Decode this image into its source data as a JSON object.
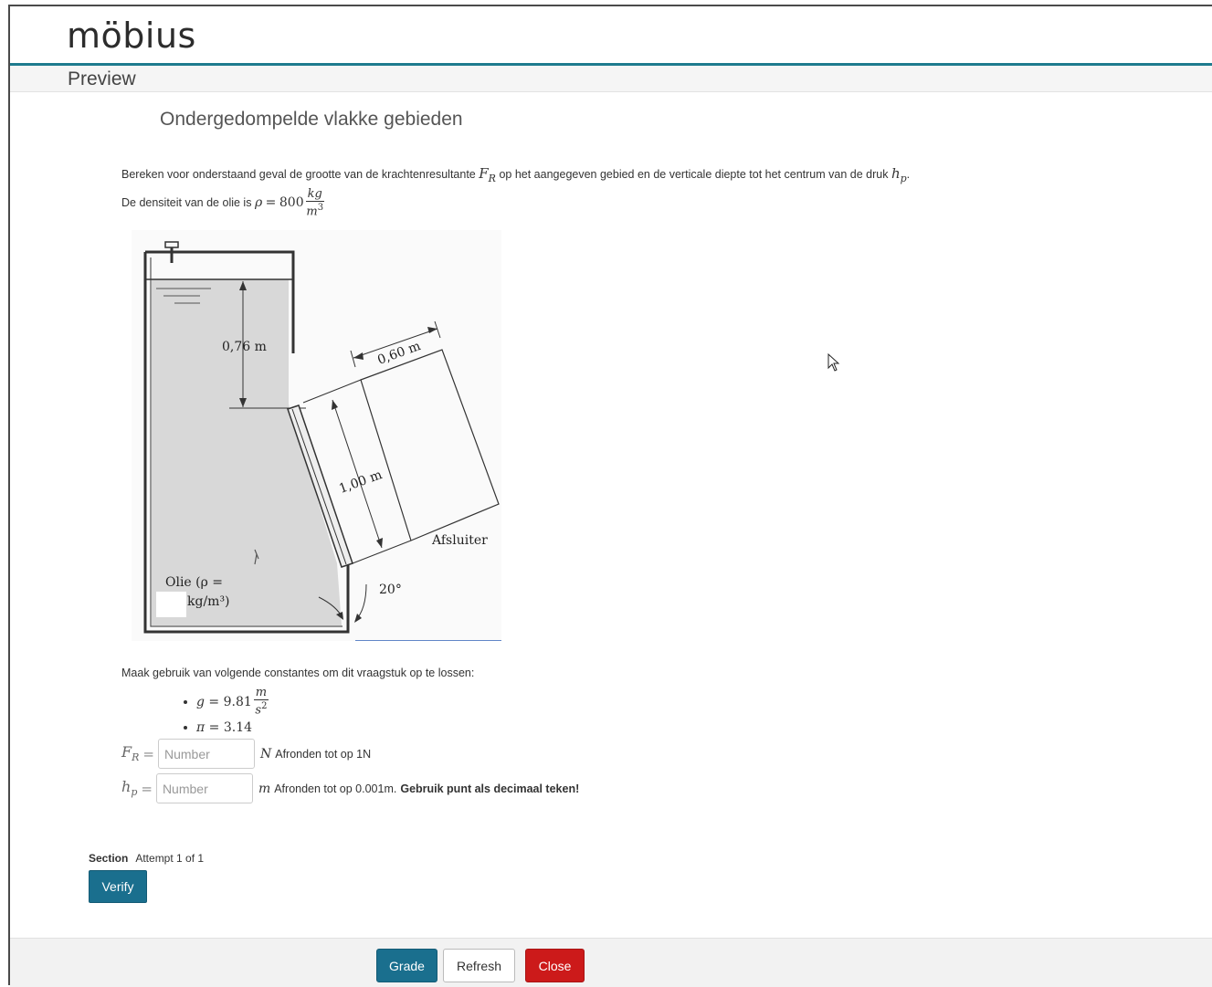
{
  "header": {
    "logo_text": "möbius",
    "preview_label": "Preview"
  },
  "question": {
    "title": "Ondergedompelde vlakke gebieden",
    "intro_before_FR": "Bereken voor onderstaand geval de grootte van de krachtenresultante",
    "FR_symbol": "F",
    "FR_sub": "R",
    "intro_middle": "op het aangegeven gebied en de verticale diepte tot het centrum van de druk",
    "hp_symbol": "h",
    "hp_sub": "p",
    "intro_end": ".",
    "density_prefix": "De densiteit van de olie is",
    "density_lhs": "ρ",
    "density_eq": "=",
    "density_value": "800",
    "density_unit_num": "kg",
    "density_unit_den": "m",
    "density_unit_den_exp": "3",
    "constants_intro": "Maak gebruik van volgende constantes om dit vraagstuk op te lossen:",
    "constants": [
      {
        "lhs": "g",
        "eq": "=",
        "value": "9.81",
        "unit_num": "m",
        "unit_den": "s",
        "unit_den_exp": "2"
      },
      {
        "lhs": "π",
        "eq": "=",
        "value": "3.14"
      }
    ]
  },
  "figure": {
    "label_depth": "0,76 m",
    "label_width": "0,60 m",
    "label_length": "1,00 m",
    "label_gate": "Afsluiter",
    "label_oil_line1": "Olie (ρ =",
    "label_oil_line2": "kg/m³)",
    "label_angle": "20°"
  },
  "answers": [
    {
      "symbol": "F",
      "sub": "R",
      "eq": "=",
      "placeholder": "Number",
      "value": "",
      "unit": "N",
      "hint": "Afronden tot op 1N",
      "hint_bold": ""
    },
    {
      "symbol": "h",
      "sub": "p",
      "eq": "=",
      "placeholder": "Number",
      "value": "",
      "unit": "m",
      "hint": "Afronden tot op 0.001m.",
      "hint_bold": "Gebruik punt als decimaal teken!"
    }
  ],
  "section": {
    "label": "Section",
    "attempt": "Attempt 1 of 1",
    "verify_label": "Verify"
  },
  "footer": {
    "grade_label": "Grade",
    "refresh_label": "Refresh",
    "close_label": "Close"
  },
  "colors": {
    "accent": "#1e7b8e",
    "primary_button": "#1a6f8e",
    "close_button": "#cc1a1a"
  }
}
